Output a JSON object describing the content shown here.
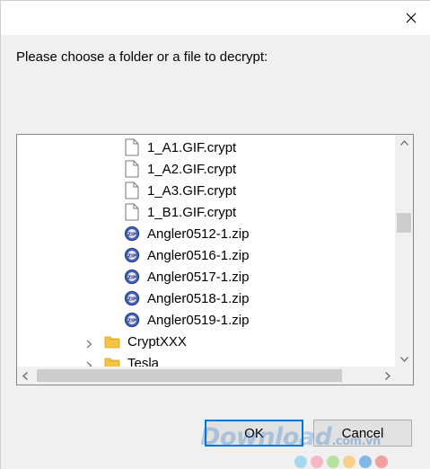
{
  "dialog": {
    "prompt": "Please choose a folder or a file to decrypt:",
    "close_icon": "close-icon"
  },
  "tree": {
    "items": [
      {
        "label": "1_A1.GIF.crypt",
        "icon": "file-icon"
      },
      {
        "label": "1_A2.GIF.crypt",
        "icon": "file-icon"
      },
      {
        "label": "1_A3.GIF.crypt",
        "icon": "file-icon"
      },
      {
        "label": "1_B1.GIF.crypt",
        "icon": "file-icon"
      },
      {
        "label": "Angler0512-1.zip",
        "icon": "zip-icon"
      },
      {
        "label": "Angler0516-1.zip",
        "icon": "zip-icon"
      },
      {
        "label": "Angler0517-1.zip",
        "icon": "zip-icon"
      },
      {
        "label": "Angler0518-1.zip",
        "icon": "zip-icon"
      },
      {
        "label": "Angler0519-1.zip",
        "icon": "zip-icon"
      },
      {
        "label": "CryptXXX",
        "icon": "folder-icon"
      },
      {
        "label": "Tesla",
        "icon": "folder-icon"
      }
    ]
  },
  "buttons": {
    "ok": "OK",
    "cancel": "Cancel"
  },
  "watermark": {
    "text": "Download",
    "tld": ".com.vn",
    "dot_colors": [
      "#a8d8f0",
      "#f5b7c5",
      "#b8e0a0",
      "#f7d08a",
      "#7fb8e8",
      "#f0a0a0"
    ]
  },
  "colors": {
    "accent": "#0078d7",
    "dialog_bg": "#f0f0f0"
  }
}
